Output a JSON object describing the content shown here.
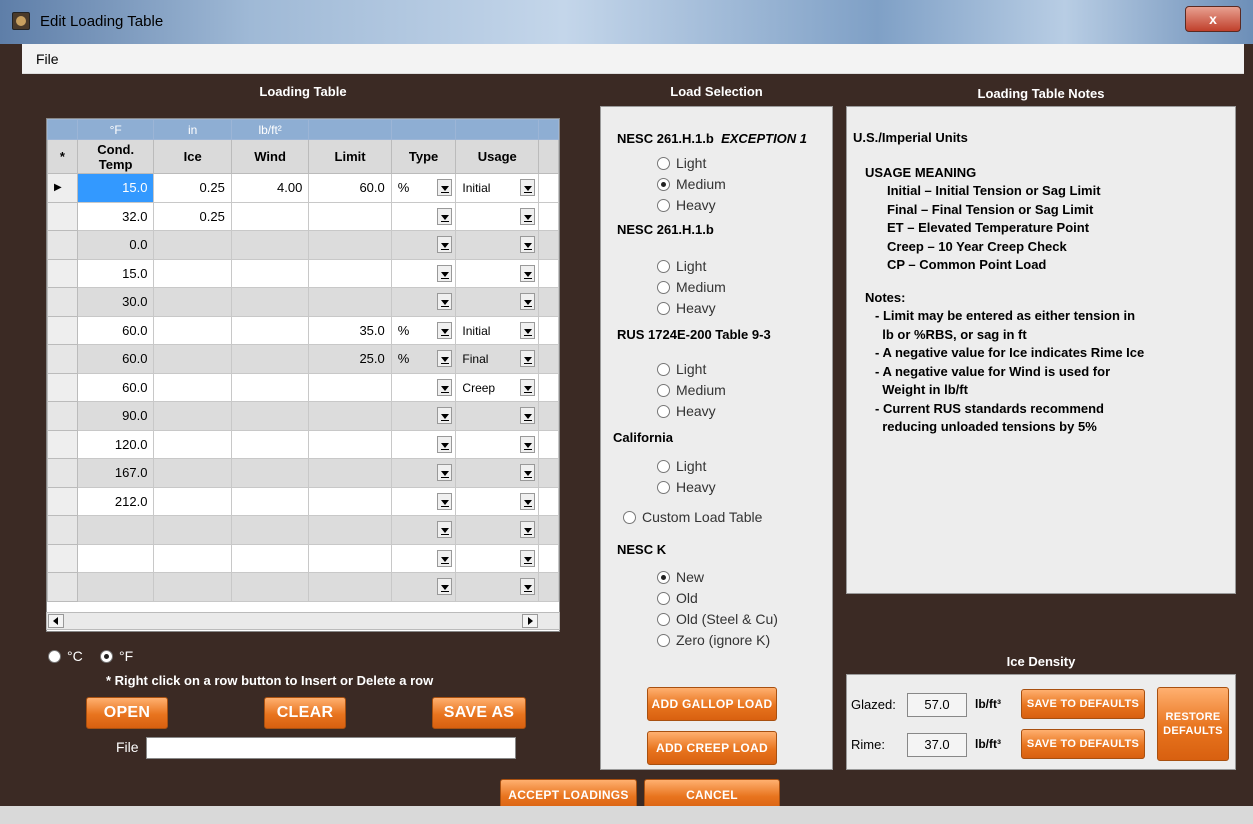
{
  "window": {
    "title": "Edit Loading Table",
    "close_label": "x"
  },
  "menu": {
    "file": "File"
  },
  "loading_table": {
    "title": "Loading Table",
    "units": [
      "",
      "°F",
      "in",
      "lb/ft²",
      "",
      "",
      ""
    ],
    "headers": [
      "*",
      "Cond. Temp",
      "Ice",
      "Wind",
      "Limit",
      "Type",
      "Usage"
    ],
    "rows": [
      {
        "marker": "▶",
        "temp": "15.0",
        "ice": "0.25",
        "wind": "4.00",
        "limit": "60.0",
        "type": "%",
        "usage": "Initial"
      },
      {
        "marker": "",
        "temp": "32.0",
        "ice": "0.25",
        "wind": "",
        "limit": "",
        "type": "",
        "usage": ""
      },
      {
        "marker": "",
        "temp": "0.0",
        "ice": "",
        "wind": "",
        "limit": "",
        "type": "",
        "usage": ""
      },
      {
        "marker": "",
        "temp": "15.0",
        "ice": "",
        "wind": "",
        "limit": "",
        "type": "",
        "usage": ""
      },
      {
        "marker": "",
        "temp": "30.0",
        "ice": "",
        "wind": "",
        "limit": "",
        "type": "",
        "usage": ""
      },
      {
        "marker": "",
        "temp": "60.0",
        "ice": "",
        "wind": "",
        "limit": "35.0",
        "type": "%",
        "usage": "Initial"
      },
      {
        "marker": "",
        "temp": "60.0",
        "ice": "",
        "wind": "",
        "limit": "25.0",
        "type": "%",
        "usage": "Final"
      },
      {
        "marker": "",
        "temp": "60.0",
        "ice": "",
        "wind": "",
        "limit": "",
        "type": "",
        "usage": "Creep"
      },
      {
        "marker": "",
        "temp": "90.0",
        "ice": "",
        "wind": "",
        "limit": "",
        "type": "",
        "usage": ""
      },
      {
        "marker": "",
        "temp": "120.0",
        "ice": "",
        "wind": "",
        "limit": "",
        "type": "",
        "usage": ""
      },
      {
        "marker": "",
        "temp": "167.0",
        "ice": "",
        "wind": "",
        "limit": "",
        "type": "",
        "usage": ""
      },
      {
        "marker": "",
        "temp": "212.0",
        "ice": "",
        "wind": "",
        "limit": "",
        "type": "",
        "usage": ""
      },
      {
        "marker": "",
        "temp": "",
        "ice": "",
        "wind": "",
        "limit": "",
        "type": "",
        "usage": ""
      },
      {
        "marker": "",
        "temp": "",
        "ice": "",
        "wind": "",
        "limit": "",
        "type": "",
        "usage": ""
      },
      {
        "marker": "",
        "temp": "",
        "ice": "",
        "wind": "",
        "limit": "",
        "type": "",
        "usage": ""
      }
    ],
    "unit_c": "°C",
    "unit_f": "°F",
    "unit_selected": "F",
    "hint": "* Right click on a row button to Insert or Delete a row",
    "open_label": "OPEN",
    "clear_label": "CLEAR",
    "save_as_label": "SAVE AS",
    "file_label": "File",
    "file_value": ""
  },
  "load_selection": {
    "title": "Load Selection",
    "nesc_exc_label": "NESC 261.H.1.b",
    "nesc_exc_italic": "EXCEPTION 1",
    "nesc_exc_options": [
      "Light",
      "Medium",
      "Heavy"
    ],
    "nesc_label": "NESC  261.H.1.b",
    "nesc_options": [
      "Light",
      "Medium",
      "Heavy"
    ],
    "rus_label": "RUS 1724E-200 Table 9-3",
    "rus_options": [
      "Light",
      "Medium",
      "Heavy"
    ],
    "california_label": "California",
    "california_options": [
      "Light",
      "Heavy"
    ],
    "custom_label": "Custom Load Table",
    "nesc_k_label": "NESC K",
    "nesc_k_options": [
      "New",
      "Old",
      "Old (Steel & Cu)",
      "Zero (ignore K)"
    ],
    "gallop_label": "ADD GALLOP LOAD",
    "creep_label": "ADD CREEP LOAD"
  },
  "notes": {
    "title": "Loading Table Notes",
    "units_line": "U.S./Imperial Units",
    "usage_heading": "USAGE MEANING",
    "usage_lines": [
      "Initial – Initial Tension or Sag Limit",
      "Final – Final Tension or Sag Limit",
      "ET – Elevated Temperature Point",
      "Creep – 10 Year Creep Check",
      "CP – Common Point Load"
    ],
    "notes_heading": "Notes:",
    "notes_lines": [
      "- Limit may be entered as either tension in",
      "  lb or %RBS, or sag in ft",
      "- A negative value for Ice indicates Rime Ice",
      "- A negative value for Wind is used for",
      "  Weight in lb/ft",
      "- Current RUS standards recommend",
      "  reducing unloaded tensions by 5%"
    ]
  },
  "ice_density": {
    "title": "Ice Density",
    "glazed_label": "Glazed:",
    "glazed_value": "57.0",
    "rime_label": "Rime:",
    "rime_value": "37.0",
    "unit": "lb/ft³",
    "save_defaults_label": "SAVE TO DEFAULTS",
    "restore_label_1": "RESTORE",
    "restore_label_2": "DEFAULTS"
  },
  "footer": {
    "accept_label": "ACCEPT LOADINGS",
    "cancel_label": "CANCEL"
  },
  "colors": {
    "frame": "#3b2a24",
    "accent_orange": "#e8741e",
    "header_blue": "#8eaed3",
    "selection": "#3399ff"
  }
}
